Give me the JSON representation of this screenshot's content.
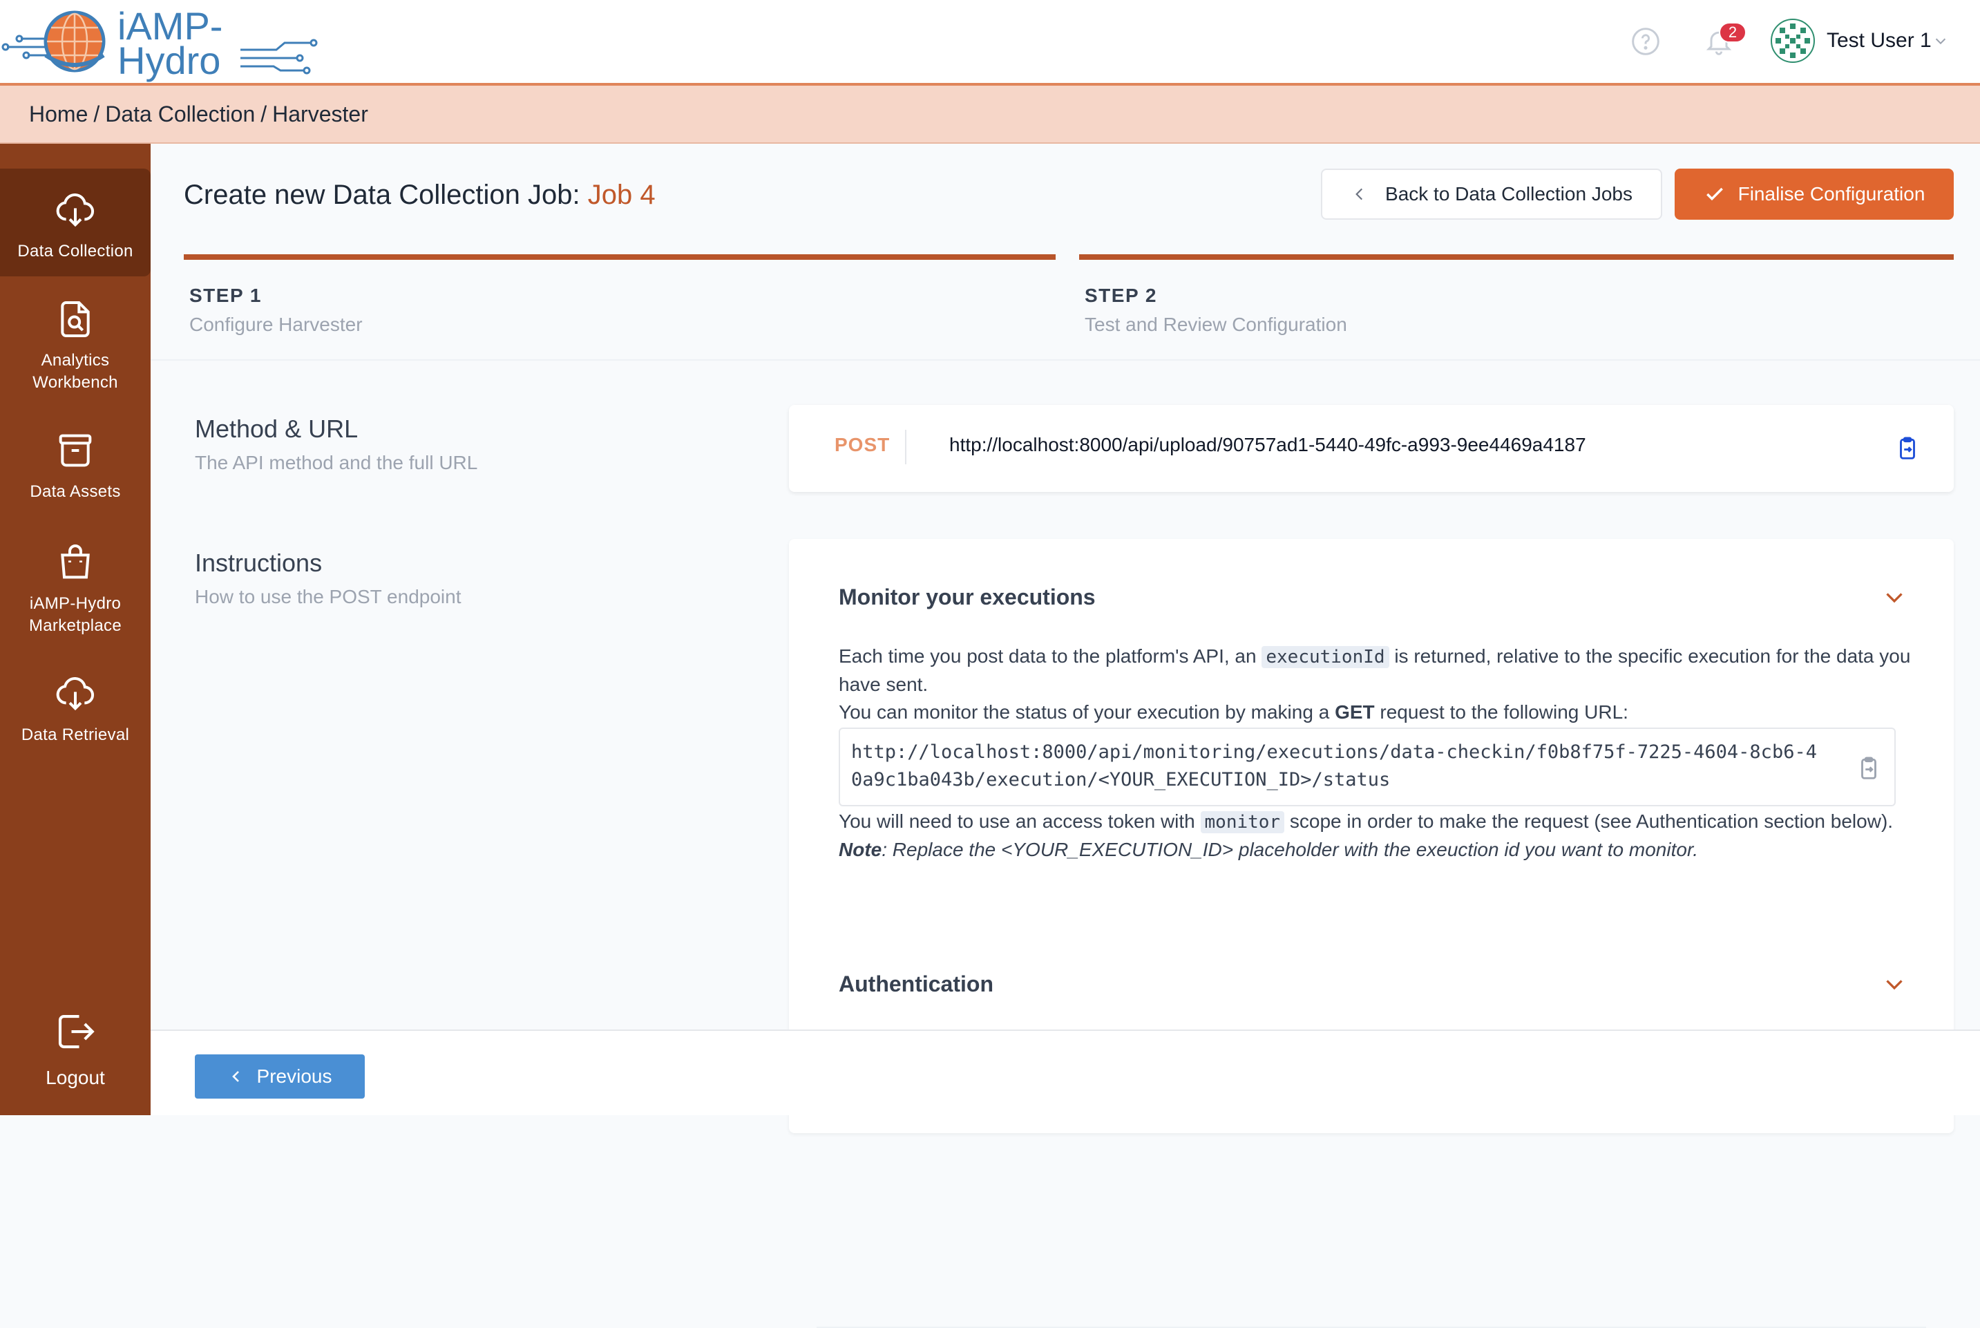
{
  "brand": {
    "line1": "iAMP-",
    "line2": "Hydro"
  },
  "header": {
    "notification_count": "2",
    "user_name": "Test User 1"
  },
  "breadcrumb": {
    "items": [
      "Home",
      "Data Collection",
      "Harvester"
    ],
    "separator": "/"
  },
  "sidebar": {
    "items": [
      {
        "label_lines": [
          "Data Collection"
        ],
        "icon": "cloud-download-icon",
        "active": true
      },
      {
        "label_lines": [
          "Analytics",
          "Workbench"
        ],
        "icon": "file-search-icon",
        "active": false
      },
      {
        "label_lines": [
          "Data Assets"
        ],
        "icon": "archive-icon",
        "active": false
      },
      {
        "label_lines": [
          "iAMP-Hydro",
          "Marketplace"
        ],
        "icon": "shopping-bag-icon",
        "active": false
      },
      {
        "label_lines": [
          "Data Retrieval"
        ],
        "icon": "cloud-download-icon",
        "active": false
      }
    ],
    "logout_label": "Logout"
  },
  "page": {
    "title_prefix": "Create new Data Collection Job:",
    "job_name": "Job 4",
    "back_button": "Back to Data Collection Jobs",
    "finalise_button": "Finalise Configuration"
  },
  "steps": [
    {
      "number": "STEP 1",
      "description": "Configure Harvester"
    },
    {
      "number": "STEP 2",
      "description": "Test and Review Configuration"
    }
  ],
  "method_url": {
    "title": "Method & URL",
    "subtitle": "The API method and the full URL",
    "method": "POST",
    "url": "http://localhost:8000/api/upload/90757ad1-5440-49fc-a993-9ee4469a4187"
  },
  "instructions": {
    "title": "Instructions",
    "subtitle": "How to use the POST endpoint",
    "monitor": {
      "title": "Monitor your executions",
      "p1_a": "Each time you post data to the platform's API, an",
      "p1_code": "executionId",
      "p1_b": "is returned, relative to the specific execution for the data you have sent.",
      "p2_a": "You can monitor the status of your execution by making a",
      "p2_bold": "GET",
      "p2_b": "request to the following URL:",
      "monitor_url": "http://localhost:8000/api/monitoring/executions/data-checkin/f0b8f75f-7225-4604-8cb6-40a9c1ba043b/execution/<YOUR_EXECUTION_ID>/status",
      "p3_a": "You will need to use an access token with",
      "p3_code": "monitor",
      "p3_b": "scope in order to make the request (see Authentication section below).",
      "note_label": "Note",
      "note_text": ": Replace the <YOUR_EXECUTION_ID> placeholder with the exeuction id you want to monitor."
    },
    "authentication": {
      "title": "Authentication"
    }
  },
  "footer": {
    "previous_button": "Previous"
  },
  "colors": {
    "accent": "#e0662f",
    "sidebar": "#8a3f1c",
    "sidebar_active": "#6a2e12",
    "breadcrumb_bg": "#f6d6c8",
    "primary_blue": "#4a8fd4"
  }
}
